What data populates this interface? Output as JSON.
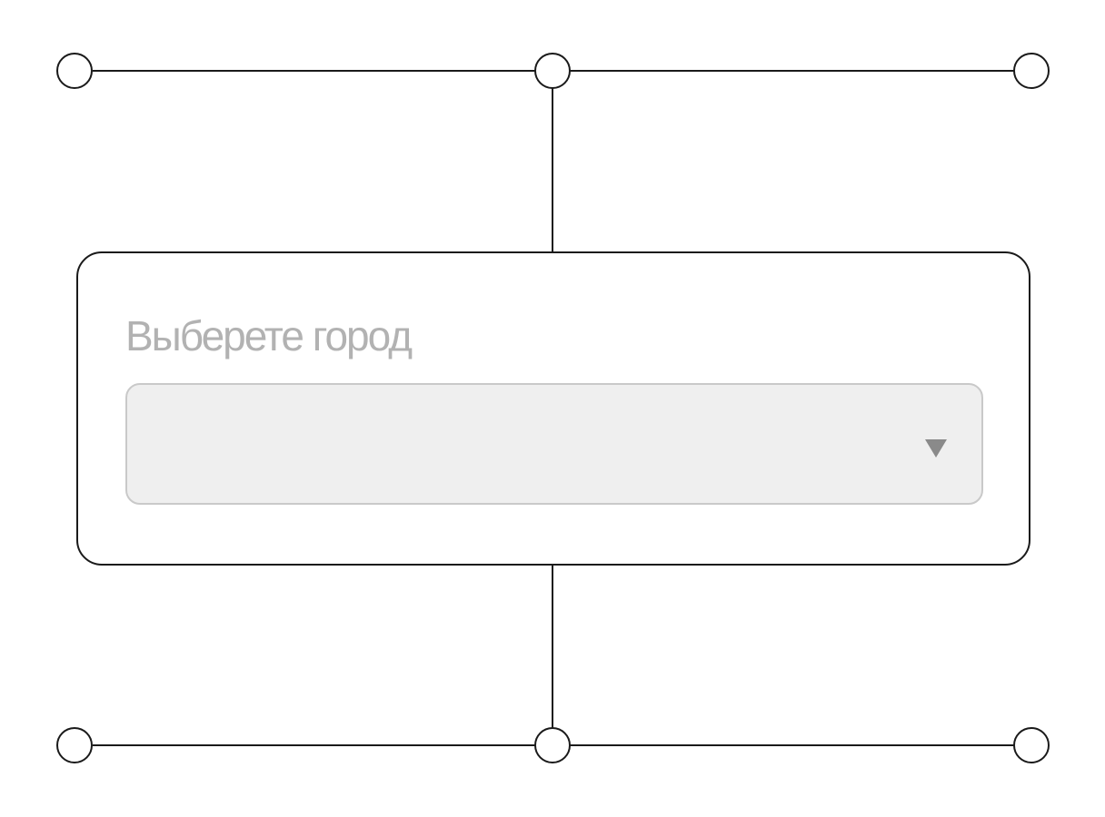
{
  "city_select": {
    "label": "Выберете город",
    "selected_value": "",
    "icon": "triangle-down-icon"
  },
  "connector_nodes": 6,
  "colors": {
    "line": "#1a1a1a",
    "label": "#b2b2b2",
    "select_bg": "#efefef",
    "select_border": "#c9c9c9",
    "chevron": "#8a8a8a"
  }
}
